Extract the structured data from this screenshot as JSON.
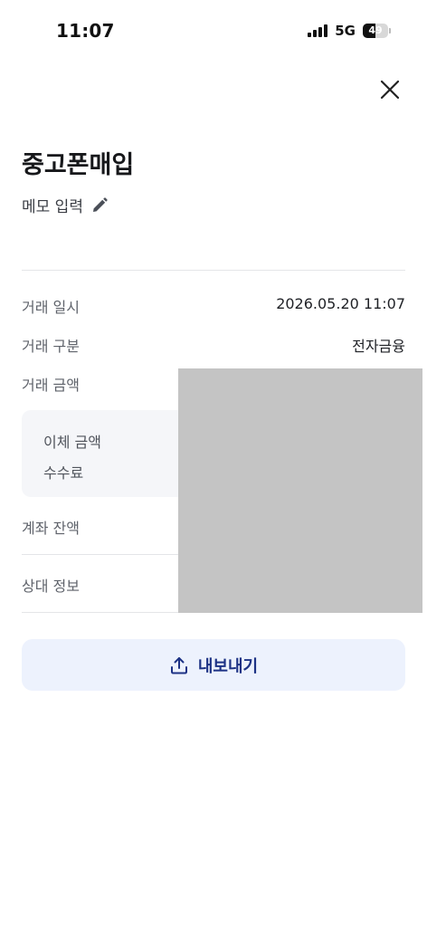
{
  "status": {
    "time": "11:07",
    "network": "5G",
    "battery": "49",
    "battery_level": 0.49
  },
  "header": {
    "title": "중고폰매입",
    "memo_label": "메모 입력"
  },
  "details": {
    "datetime_label": "거래 일시",
    "datetime_value": "2026.05.20 11:07",
    "type_label": "거래 구분",
    "type_value": "전자금융",
    "amount_label": "거래 금액",
    "transfer_amount_label": "이체 금액",
    "fee_label": "수수료",
    "balance_label": "계좌 잔액",
    "counterparty_label": "상대 정보"
  },
  "actions": {
    "export_label": "내보내기"
  },
  "icons": {
    "close": "close-icon",
    "edit": "pencil-icon",
    "export": "upload-icon"
  },
  "colors": {
    "accent": "#1d3285",
    "button_bg": "#edf2fd",
    "redaction": "#c4c4c4"
  }
}
